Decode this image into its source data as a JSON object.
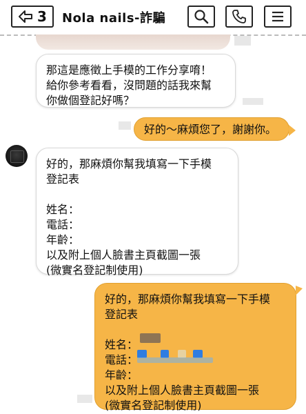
{
  "header": {
    "back_count": "3",
    "title": "Nola nails-詐騙"
  },
  "messages": {
    "m1": "那這是應徵上手模的工作分享唷！\n給你參考看看，沒問題的話我來幫\n你做個登記好嗎？",
    "m2": "好的～麻煩您了，謝謝你。",
    "m3": "好的，那麻煩你幫我填寫一下手模\n登記表\n\n姓名：\n電話：\n年齡：\n以及附上個人臉書主頁截圖一張\n(微實名登記制使用)",
    "m4": "好的，那麻煩你幫我填寫一下手模\n登記表\n\n姓名：\n電話：\n年齡：\n以及附上個人臉書主頁截圖一張\n(微實名登記制使用)"
  },
  "colors": {
    "outgoing_bubble": "#f6b547",
    "incoming_bubble": "#ffffff",
    "redaction_blue": "#2f7de1"
  },
  "icons": {
    "back": "arrow-left-icon",
    "search": "search-icon",
    "phone": "phone-icon",
    "menu": "menu-icon"
  }
}
